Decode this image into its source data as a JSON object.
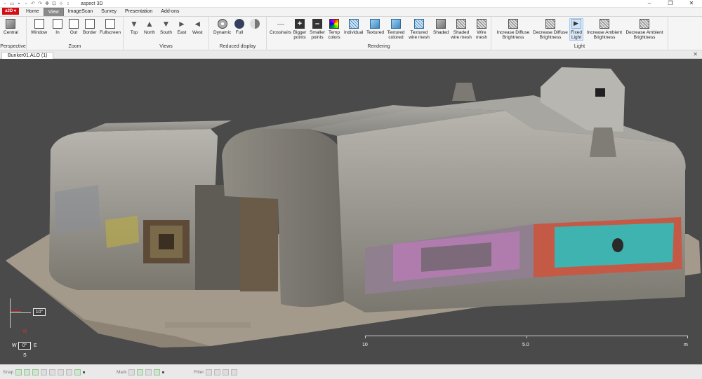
{
  "titlebar": {
    "app_title": "aspect 3D",
    "minimize": "–",
    "maximize": "❐",
    "close": "✕"
  },
  "menu": {
    "app_button": "a3D ▾",
    "tabs": [
      "Home",
      "View",
      "ImageScan",
      "Survey",
      "Presentation",
      "Add-ons"
    ],
    "active_tab": "View"
  },
  "ribbon": {
    "groups": {
      "perspective": {
        "label": "Perspective",
        "buttons": [
          "Central"
        ]
      },
      "zoom": {
        "label": "Zoom",
        "buttons": [
          "Window",
          "In",
          "Out",
          "Border",
          "Fullscreen"
        ]
      },
      "views": {
        "label": "Views",
        "buttons": [
          "Top",
          "North",
          "South",
          "East",
          "West"
        ]
      },
      "reduced": {
        "label": "Reduced display",
        "buttons": [
          "Dynamic",
          "Full"
        ]
      },
      "rendering": {
        "label": "Rendering",
        "buttons": [
          "Crosshairs",
          "Bigger points",
          "Smaller points",
          "Temp colors",
          "Individual",
          "Textured",
          "Textured colored",
          "Textured wire mesh",
          "Shaded",
          "Shaded wire mesh",
          "Wire mesh"
        ]
      },
      "light": {
        "label": "Light",
        "buttons": [
          "Increase Diffuse Brightness",
          "Decrease Diffuse Brightness",
          "Fixed Light",
          "Increase Ambient Brightness",
          "Decrease Ambient Brightness"
        ]
      }
    }
  },
  "document": {
    "tab_title": "Bunker01.ALO (1)",
    "close": "✕"
  },
  "viewport": {
    "tilt_angle": "10°",
    "compass": {
      "north": "N",
      "south": "S",
      "east": "E",
      "west": "W",
      "heading": "0°"
    },
    "scale": {
      "labels": [
        "10",
        "5.0",
        "m"
      ]
    }
  },
  "statusbar": {
    "snap_label": "Snap",
    "mark_label": "Mark",
    "filter_label": "Filter"
  }
}
